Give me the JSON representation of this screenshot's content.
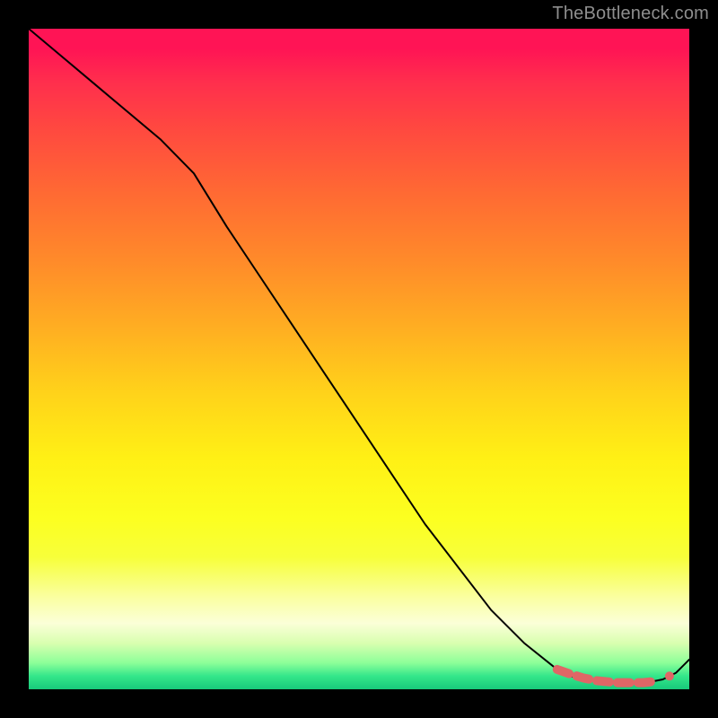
{
  "watermark": "TheBottleneck.com",
  "colors": {
    "frame": "#000000",
    "line": "#000000",
    "marker": "#e06666",
    "gradient_top": "#ff1455",
    "gradient_bottom": "#18c97a"
  },
  "chart_data": {
    "type": "line",
    "title": "",
    "xlabel": "",
    "ylabel": "",
    "xlim": [
      0,
      100
    ],
    "ylim": [
      0,
      100
    ],
    "grid": false,
    "legend": false,
    "series": [
      {
        "name": "curve",
        "x": [
          0,
          5,
          10,
          15,
          20,
          25,
          30,
          35,
          40,
          45,
          50,
          55,
          60,
          65,
          70,
          75,
          80,
          82,
          84,
          86,
          88,
          90,
          92,
          94,
          96,
          98,
          100
        ],
        "y": [
          100,
          95.8,
          91.6,
          87.4,
          83.2,
          78.1,
          70.0,
          62.5,
          55.0,
          47.5,
          40.0,
          32.5,
          25.0,
          18.5,
          12.0,
          7.0,
          3.0,
          2.0,
          1.5,
          1.2,
          1.0,
          1.0,
          1.0,
          1.1,
          1.5,
          2.5,
          4.5
        ]
      }
    ],
    "markers": {
      "name": "highlight-dots",
      "approx_x": [
        80,
        82,
        83,
        84,
        85,
        86,
        87,
        88,
        89,
        90,
        91,
        92,
        93,
        94,
        95
      ],
      "approx_y": [
        3.0,
        2.3,
        2.0,
        1.7,
        1.5,
        1.3,
        1.2,
        1.1,
        1.0,
        1.0,
        1.0,
        1.0,
        1.0,
        1.1,
        1.3
      ]
    }
  }
}
